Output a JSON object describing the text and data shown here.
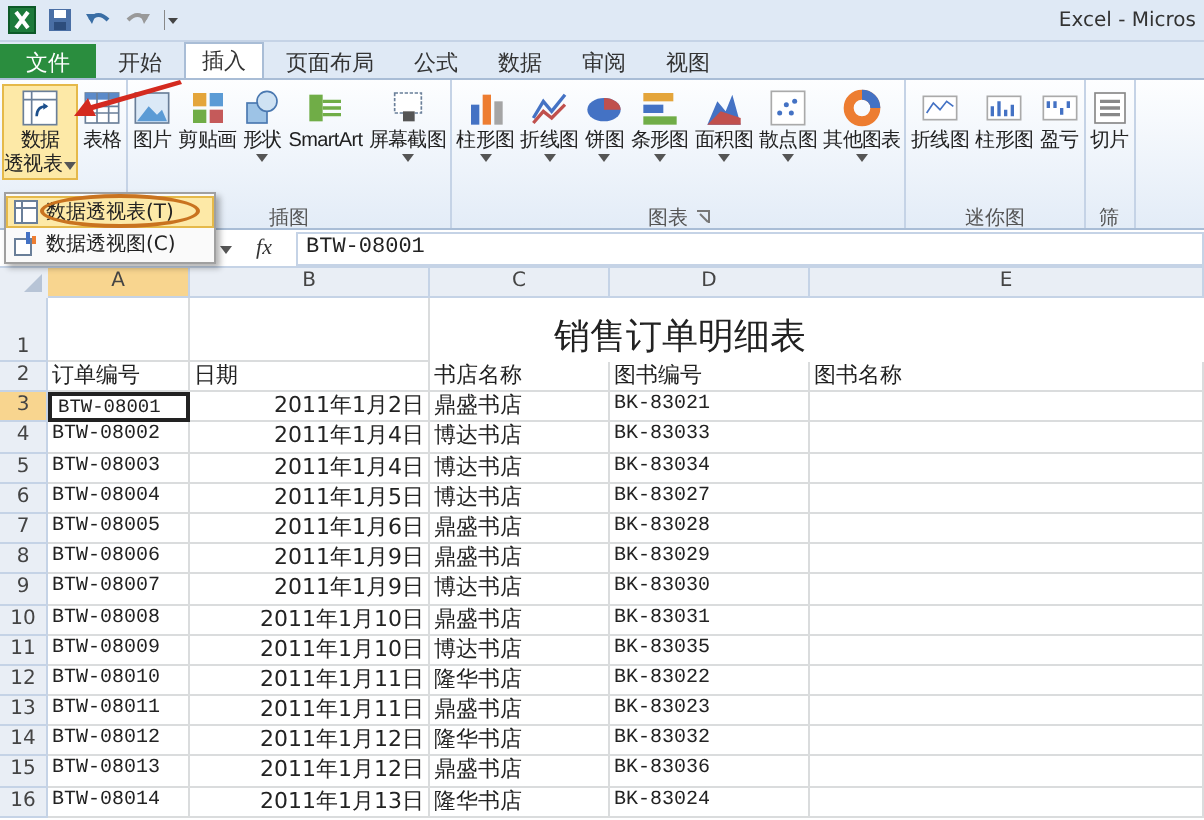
{
  "title_bar": {
    "title": "Excel - Micros"
  },
  "tabs": [
    {
      "label": "文件",
      "kind": "file",
      "selected": false
    },
    {
      "label": "开始",
      "kind": "tab",
      "selected": false
    },
    {
      "label": "插入",
      "kind": "tab",
      "selected": true
    },
    {
      "label": "页面布局",
      "kind": "tab",
      "selected": false
    },
    {
      "label": "公式",
      "kind": "tab",
      "selected": false
    },
    {
      "label": "数据",
      "kind": "tab",
      "selected": false
    },
    {
      "label": "审阅",
      "kind": "tab",
      "selected": false
    },
    {
      "label": "视图",
      "kind": "tab",
      "selected": false
    }
  ],
  "ribbon": {
    "groups": [
      {
        "buttons": [
          {
            "label_lines": [
              "数据",
              "透视表"
            ],
            "has_menu": true,
            "pressed": true
          },
          {
            "label": "表格",
            "has_menu": false,
            "pressed": false
          }
        ]
      },
      {
        "label": "插图",
        "buttons": [
          {
            "label": "图片",
            "has_menu": false,
            "pressed": false
          },
          {
            "label": "剪贴画",
            "has_menu": false,
            "pressed": false
          },
          {
            "label": "形状",
            "has_menu": true,
            "pressed": false
          },
          {
            "label": "SmartArt",
            "has_menu": false,
            "pressed": false
          },
          {
            "label": "屏幕截图",
            "has_menu": true,
            "pressed": false
          }
        ]
      },
      {
        "label": "图表",
        "launcher": true,
        "buttons": [
          {
            "label": "柱形图",
            "has_menu": true,
            "pressed": false
          },
          {
            "label": "折线图",
            "has_menu": true,
            "pressed": false
          },
          {
            "label": "饼图",
            "has_menu": true,
            "pressed": false
          },
          {
            "label": "条形图",
            "has_menu": true,
            "pressed": false
          },
          {
            "label": "面积图",
            "has_menu": true,
            "pressed": false
          },
          {
            "label": "散点图",
            "has_menu": true,
            "pressed": false
          },
          {
            "label": "其他图表",
            "has_menu": true,
            "pressed": false
          }
        ]
      },
      {
        "label": "迷你图",
        "buttons": [
          {
            "label": "折线图",
            "has_menu": false,
            "pressed": false
          },
          {
            "label": "柱形图",
            "has_menu": false,
            "pressed": false
          },
          {
            "label": "盈亏",
            "has_menu": false,
            "pressed": false
          }
        ]
      },
      {
        "label": "筛",
        "buttons": [
          {
            "label": "切片",
            "has_menu": false,
            "pressed": false
          }
        ]
      }
    ]
  },
  "dropdown_menu": {
    "items": [
      {
        "label": "数据透视表(T)",
        "selected": true
      },
      {
        "label": "数据透视图(C)",
        "selected": false
      }
    ]
  },
  "formula_bar": {
    "function_label": "fx",
    "formula": "BTW-08001"
  },
  "sheet": {
    "columns": [
      {
        "letter": "A",
        "selected": true
      },
      {
        "letter": "B",
        "selected": false
      },
      {
        "letter": "C",
        "selected": false
      },
      {
        "letter": "D",
        "selected": false
      },
      {
        "letter": "E",
        "selected": false
      }
    ],
    "title_row": {
      "number": "1",
      "title": "销售订单明细表"
    },
    "header_row": {
      "number": "2",
      "cells": [
        "订单编号",
        "日期",
        "书店名称",
        "图书编号",
        "图书名称"
      ]
    },
    "rows": [
      {
        "number": "3",
        "selected": true,
        "cells": [
          "BTW-08001",
          "2011年1月2日",
          "鼎盛书店",
          "BK-83021"
        ]
      },
      {
        "number": "4",
        "selected": false,
        "cells": [
          "BTW-08002",
          "2011年1月4日",
          "博达书店",
          "BK-83033"
        ]
      },
      {
        "number": "5",
        "selected": false,
        "cells": [
          "BTW-08003",
          "2011年1月4日",
          "博达书店",
          "BK-83034"
        ]
      },
      {
        "number": "6",
        "selected": false,
        "cells": [
          "BTW-08004",
          "2011年1月5日",
          "博达书店",
          "BK-83027"
        ]
      },
      {
        "number": "7",
        "selected": false,
        "cells": [
          "BTW-08005",
          "2011年1月6日",
          "鼎盛书店",
          "BK-83028"
        ]
      },
      {
        "number": "8",
        "selected": false,
        "cells": [
          "BTW-08006",
          "2011年1月9日",
          "鼎盛书店",
          "BK-83029"
        ]
      },
      {
        "number": "9",
        "selected": false,
        "cells": [
          "BTW-08007",
          "2011年1月9日",
          "博达书店",
          "BK-83030"
        ]
      },
      {
        "number": "10",
        "selected": false,
        "cells": [
          "BTW-08008",
          "2011年1月10日",
          "鼎盛书店",
          "BK-83031"
        ]
      },
      {
        "number": "11",
        "selected": false,
        "cells": [
          "BTW-08009",
          "2011年1月10日",
          "博达书店",
          "BK-83035"
        ]
      },
      {
        "number": "12",
        "selected": false,
        "cells": [
          "BTW-08010",
          "2011年1月11日",
          "隆华书店",
          "BK-83022"
        ]
      },
      {
        "number": "13",
        "selected": false,
        "cells": [
          "BTW-08011",
          "2011年1月11日",
          "鼎盛书店",
          "BK-83023"
        ]
      },
      {
        "number": "14",
        "selected": false,
        "cells": [
          "BTW-08012",
          "2011年1月12日",
          "隆华书店",
          "BK-83032"
        ]
      },
      {
        "number": "15",
        "selected": false,
        "cells": [
          "BTW-08013",
          "2011年1月12日",
          "鼎盛书店",
          "BK-83036"
        ]
      },
      {
        "number": "16",
        "selected": false,
        "cells": [
          "BTW-08014",
          "2011年1月13日",
          "隆华书店",
          "BK-83024"
        ]
      }
    ]
  }
}
